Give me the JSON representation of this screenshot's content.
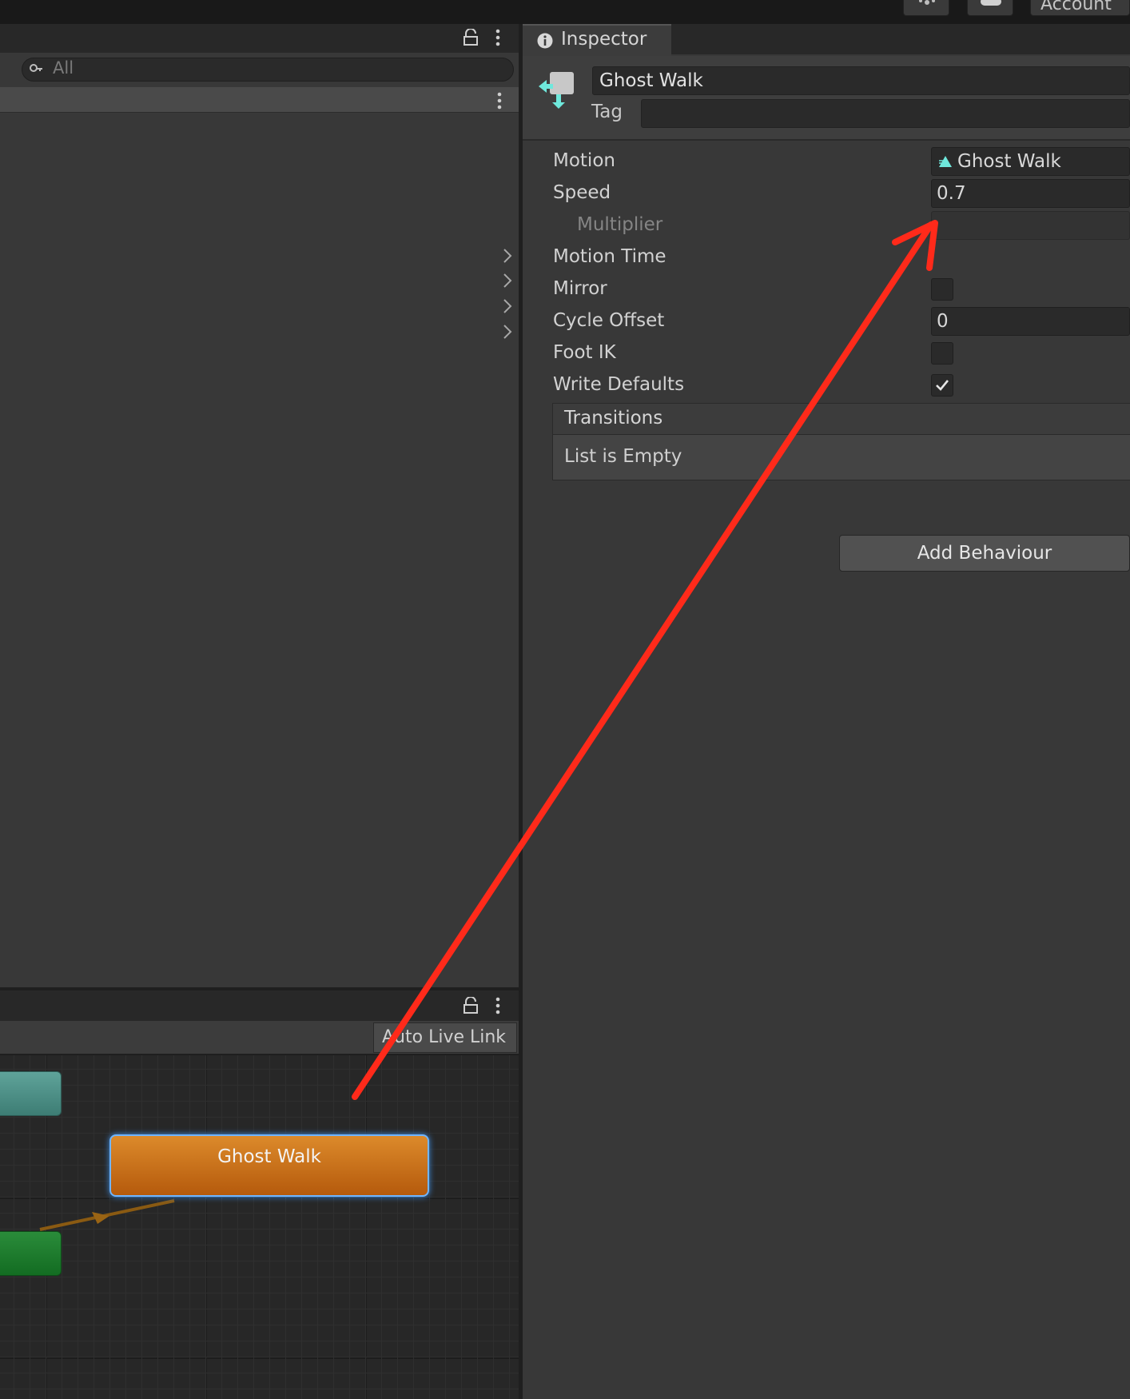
{
  "toolbar": {
    "account_label": "Account"
  },
  "hierarchy": {
    "search_placeholder": "All"
  },
  "animator": {
    "auto_live_link_label": "Auto Live Link",
    "state_node_label": "Ghost Walk"
  },
  "inspector": {
    "tab_label": "Inspector",
    "name_value": "Ghost Walk",
    "tag_label": "Tag",
    "properties": {
      "motion_label": "Motion",
      "motion_value": "Ghost Walk",
      "speed_label": "Speed",
      "speed_value": "0.7",
      "multiplier_label": "Multiplier",
      "motion_time_label": "Motion Time",
      "mirror_label": "Mirror",
      "mirror_checked": false,
      "cycle_offset_label": "Cycle Offset",
      "cycle_offset_value": "0",
      "foot_ik_label": "Foot IK",
      "foot_ik_checked": false,
      "write_defaults_label": "Write Defaults",
      "write_defaults_checked": true
    },
    "transitions": {
      "header": "Transitions",
      "empty_text": "List is Empty"
    },
    "add_behaviour_label": "Add Behaviour"
  },
  "colors": {
    "accent_arrow": "#ff2a1a",
    "state_orange": "#c96a14",
    "state_highlight": "#6fb5ff",
    "icon_teal": "#6fe8dc"
  }
}
